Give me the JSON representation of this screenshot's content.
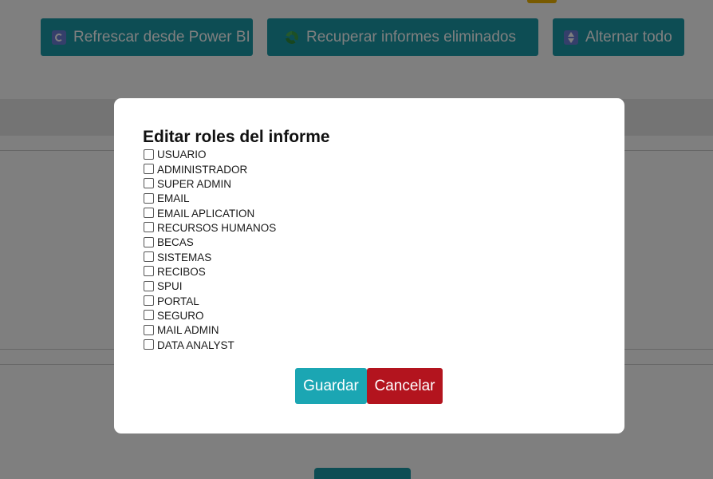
{
  "toolbar": {
    "refresh_label": "Refrescar desde Power BI",
    "recover_label": "Recuperar informes eliminados",
    "toggle_label": "Alternar todo"
  },
  "icons": {
    "refresh": "refresh-icon",
    "recover": "recycle-icon",
    "toggle": "toggle-arrows-icon"
  },
  "colors": {
    "primary": "#1b9aa8",
    "save": "#1ba6b3",
    "cancel": "#b3141e",
    "accent_yellow": "#f0b400"
  },
  "modal": {
    "title": "Editar roles del informe",
    "roles": [
      {
        "label": "USUARIO",
        "checked": false
      },
      {
        "label": "ADMINISTRADOR",
        "checked": false
      },
      {
        "label": "SUPER ADMIN",
        "checked": false
      },
      {
        "label": "EMAIL",
        "checked": false
      },
      {
        "label": "EMAIL APLICATION",
        "checked": false
      },
      {
        "label": "RECURSOS HUMANOS",
        "checked": false
      },
      {
        "label": "BECAS",
        "checked": false
      },
      {
        "label": "SISTEMAS",
        "checked": false
      },
      {
        "label": "RECIBOS",
        "checked": false
      },
      {
        "label": "SPUI",
        "checked": false
      },
      {
        "label": "PORTAL",
        "checked": false
      },
      {
        "label": "SEGURO",
        "checked": false
      },
      {
        "label": "MAIL ADMIN",
        "checked": false
      },
      {
        "label": "DATA ANALYST",
        "checked": false
      }
    ],
    "save_label": "Guardar",
    "cancel_label": "Cancelar"
  }
}
